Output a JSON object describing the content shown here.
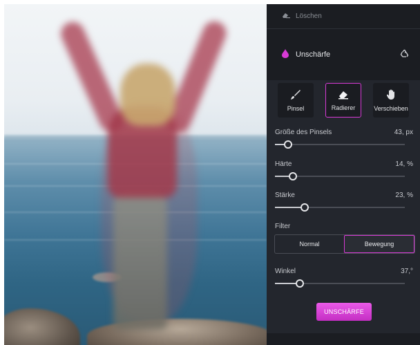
{
  "panel": {
    "clear_label": "Löschen",
    "section_title": "Unschärfe",
    "tools": [
      {
        "label": "Pinsel",
        "icon": "brush-icon",
        "active": false
      },
      {
        "label": "Radierer",
        "icon": "eraser-icon",
        "active": true
      },
      {
        "label": "Verschieben",
        "icon": "hand-icon",
        "active": false
      }
    ],
    "sliders": {
      "brush_size": {
        "label": "Größe des Pinsels",
        "value": "43, px",
        "fraction": 0.1
      },
      "hardness": {
        "label": "Härte",
        "value": "14, %",
        "fraction": 0.14
      },
      "strength": {
        "label": "Stärke",
        "value": "23, %",
        "fraction": 0.23
      },
      "angle": {
        "label": "Winkel",
        "value": "37,°",
        "fraction": 0.19
      }
    },
    "filter": {
      "label": "Filter",
      "options": [
        "Normal",
        "Bewegung"
      ],
      "selected": "Bewegung"
    },
    "apply_label": "UNSCHÄRFE"
  },
  "colors": {
    "accent": "#d83ad6",
    "panel_bg": "#23262d",
    "panel_dark": "#1b1d22"
  }
}
